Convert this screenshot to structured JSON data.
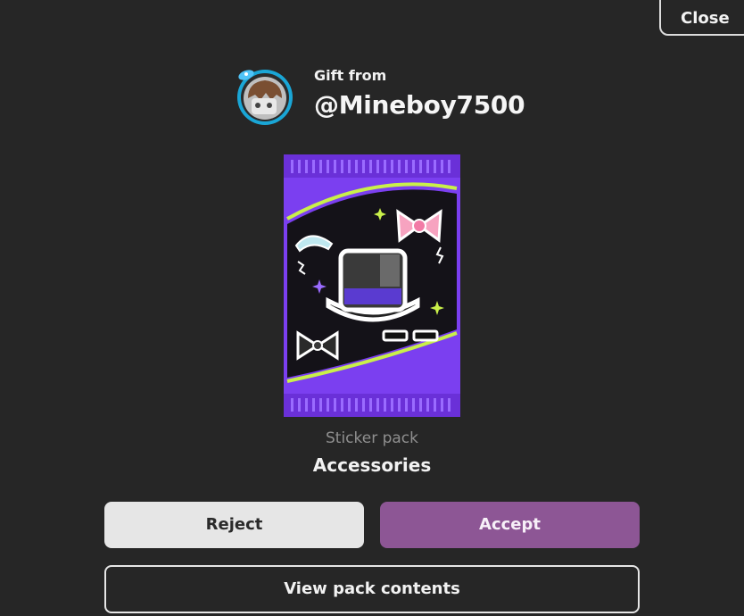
{
  "close_label": "Close",
  "sender": {
    "prefix": "Gift from",
    "username": "@Mineboy7500",
    "avatar_icon": "player-avatar-icon"
  },
  "pack": {
    "type": "Sticker pack",
    "name": "Accessories",
    "art_icon": "sticker-pack-art",
    "colors": {
      "wrapper": "#7b3ff0",
      "accent": "#c9f04a"
    }
  },
  "actions": {
    "reject_label": "Reject",
    "accept_label": "Accept",
    "view_label": "View pack contents"
  },
  "colors": {
    "background": "#262626",
    "accept": "#8d5695",
    "reject": "#e6e6e6"
  }
}
